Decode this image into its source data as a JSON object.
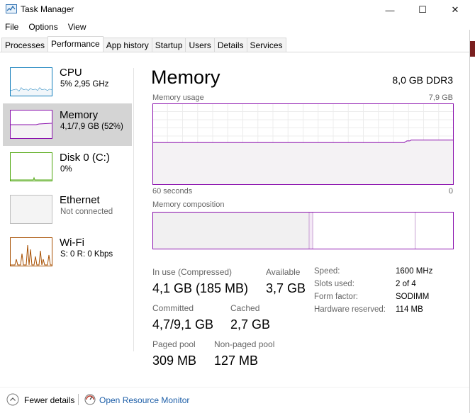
{
  "window": {
    "title": "Task Manager",
    "controls": {
      "minimize": "—",
      "maximize": "☐",
      "close": "✕"
    }
  },
  "menu": [
    "File",
    "Options",
    "View"
  ],
  "tabs": [
    {
      "label": "Processes",
      "active": false
    },
    {
      "label": "Performance",
      "active": true
    },
    {
      "label": "App history",
      "active": false
    },
    {
      "label": "Startup",
      "active": false
    },
    {
      "label": "Users",
      "active": false
    },
    {
      "label": "Details",
      "active": false
    },
    {
      "label": "Services",
      "active": false
    }
  ],
  "sidebar": [
    {
      "name": "CPU",
      "sub": "5%  2,95 GHz",
      "color": "#117dbb",
      "selected": false
    },
    {
      "name": "Memory",
      "sub": "4,1/7,9 GB (52%)",
      "color": "#8b12ae",
      "selected": true
    },
    {
      "name": "Disk 0 (C:)",
      "sub": "0%",
      "color": "#4da60c",
      "selected": false
    },
    {
      "name": "Ethernet",
      "sub": "Not connected",
      "color": "#bfbfbf",
      "selected": false
    },
    {
      "name": "Wi-Fi",
      "sub": "S: 0  R: 0 Kbps",
      "color": "#a74f01",
      "selected": false
    }
  ],
  "memory": {
    "title": "Memory",
    "spec": "8,0 GB DDR3",
    "usage_label": "Memory usage",
    "usage_max": "7,9 GB",
    "time_left": "60 seconds",
    "time_right": "0",
    "usage_history_fraction": [
      0.52,
      0.52,
      0.52,
      0.522,
      0.52,
      0.52,
      0.52,
      0.52,
      0.52,
      0.52,
      0.52,
      0.52,
      0.52,
      0.52,
      0.52,
      0.52,
      0.52,
      0.52,
      0.52,
      0.52,
      0.52,
      0.52,
      0.52,
      0.52,
      0.52,
      0.52,
      0.52,
      0.52,
      0.52,
      0.52,
      0.52,
      0.52,
      0.52,
      0.52,
      0.52,
      0.52,
      0.52,
      0.52,
      0.52,
      0.52,
      0.52,
      0.52,
      0.52,
      0.52,
      0.52,
      0.52,
      0.52,
      0.52,
      0.52,
      0.52,
      0.52,
      0.52,
      0.52,
      0.52,
      0.52,
      0.52,
      0.52,
      0.52,
      0.52,
      0.52,
      0.52,
      0.52,
      0.52,
      0.52,
      0.52,
      0.52,
      0.52,
      0.52,
      0.52,
      0.52,
      0.52,
      0.52,
      0.52,
      0.52,
      0.52,
      0.52,
      0.52,
      0.52,
      0.52,
      0.52,
      0.52,
      0.52,
      0.52,
      0.52,
      0.52,
      0.52,
      0.52,
      0.52,
      0.52,
      0.52,
      0.52,
      0.52,
      0.52,
      0.52,
      0.52,
      0.52,
      0.52,
      0.52,
      0.52,
      0.52,
      0.52,
      0.52,
      0.52,
      0.52,
      0.52,
      0.52,
      0.52,
      0.52,
      0.52,
      0.52,
      0.52,
      0.52,
      0.52,
      0.52,
      0.52,
      0.52,
      0.52,
      0.52,
      0.52,
      0.52,
      0.52,
      0.52,
      0.52,
      0.52,
      0.52,
      0.52,
      0.52,
      0.52,
      0.52,
      0.52,
      0.52,
      0.52,
      0.52,
      0.52,
      0.52,
      0.52,
      0.52,
      0.52,
      0.52,
      0.52,
      0.52,
      0.52,
      0.52,
      0.52,
      0.52,
      0.52,
      0.52,
      0.52,
      0.52,
      0.52,
      0.52,
      0.52,
      0.52,
      0.52,
      0.52,
      0.52,
      0.52,
      0.52,
      0.52,
      0.52,
      0.52,
      0.52,
      0.52,
      0.52,
      0.52,
      0.52,
      0.52,
      0.52,
      0.52,
      0.52,
      0.52,
      0.52,
      0.52,
      0.52,
      0.52,
      0.52,
      0.52,
      0.52,
      0.52,
      0.52,
      0.52,
      0.52,
      0.52,
      0.52,
      0.53,
      0.54,
      0.54,
      0.54,
      0.55,
      0.55,
      0.55,
      0.55,
      0.55,
      0.55,
      0.55,
      0.55,
      0.55,
      0.55,
      0.55,
      0.55,
      0.55,
      0.55,
      0.55,
      0.55,
      0.55,
      0.55,
      0.55,
      0.55,
      0.55,
      0.55,
      0.55,
      0.55,
      0.55,
      0.55,
      0.55,
      0.55,
      0.55,
      0.55,
      0.55,
      0.55
    ],
    "composition_label": "Memory composition",
    "composition": {
      "in_use": 0.52,
      "modified": 0.012,
      "standby": 0.34,
      "free": 0.128
    },
    "stats": {
      "in_use_label": "In use (Compressed)",
      "in_use_value": "4,1 GB (185 MB)",
      "available_label": "Available",
      "available_value": "3,7 GB",
      "committed_label": "Committed",
      "committed_value": "4,7/9,1 GB",
      "cached_label": "Cached",
      "cached_value": "2,7 GB",
      "paged_label": "Paged pool",
      "paged_value": "309 MB",
      "nonpaged_label": "Non-paged pool",
      "nonpaged_value": "127 MB"
    },
    "specs": [
      {
        "label": "Speed:",
        "value": "1600 MHz"
      },
      {
        "label": "Slots used:",
        "value": "2 of 4"
      },
      {
        "label": "Form factor:",
        "value": "SODIMM"
      },
      {
        "label": "Hardware reserved:",
        "value": "114 MB"
      }
    ]
  },
  "footer": {
    "fewer": "Fewer details",
    "resource_monitor": "Open Resource Monitor"
  },
  "colors": {
    "memory_accent": "#8b12ae",
    "grid": "#ececec",
    "link": "#1e5fa8"
  }
}
